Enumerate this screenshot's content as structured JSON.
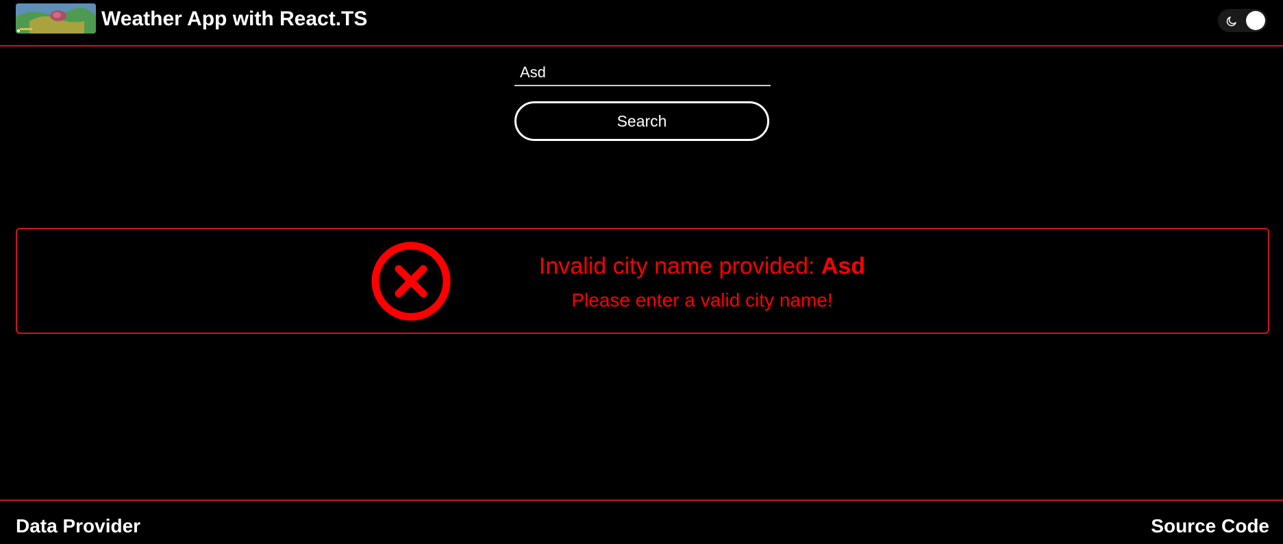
{
  "header": {
    "title": "Weather App with React.TS",
    "logo_icon": "weather-map-logo",
    "theme_toggle": {
      "icon": "moon-icon",
      "state": "dark"
    }
  },
  "search": {
    "input_value": "Asd",
    "button_label": "Search"
  },
  "error": {
    "icon": "error-x-circle-icon",
    "message_prefix": "Invalid city name provided: ",
    "city": "Asd",
    "hint": "Please enter a valid city name!"
  },
  "footer": {
    "left_link": "Data Provider",
    "right_link": "Source Code"
  },
  "colors": {
    "background": "#000000",
    "accent_red": "#d0141c",
    "error_red": "#ff0000",
    "text": "#ffffff"
  }
}
